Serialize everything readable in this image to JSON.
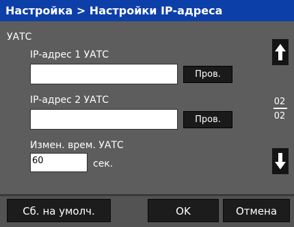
{
  "title": "Настройка > Настройки IP-адреса",
  "section_label": "УАТС",
  "fields": [
    {
      "label": "IP-адрес 1 УАТС",
      "value": "",
      "button": "Пров."
    },
    {
      "label": "IP-адрес 2 УАТС",
      "value": "",
      "button": "Пров."
    }
  ],
  "time_change": {
    "label": "Измен. врем. УАТС",
    "value": "60",
    "unit": "сек."
  },
  "pager": {
    "current": "02",
    "total": "02"
  },
  "softkeys": {
    "default": "Сб. на умолч.",
    "ok": "OK",
    "cancel": "Отмена"
  },
  "colors": {
    "title_bar": "#0d3fa8",
    "panel": "#5d5d5d",
    "button": "#1a1a1a"
  }
}
